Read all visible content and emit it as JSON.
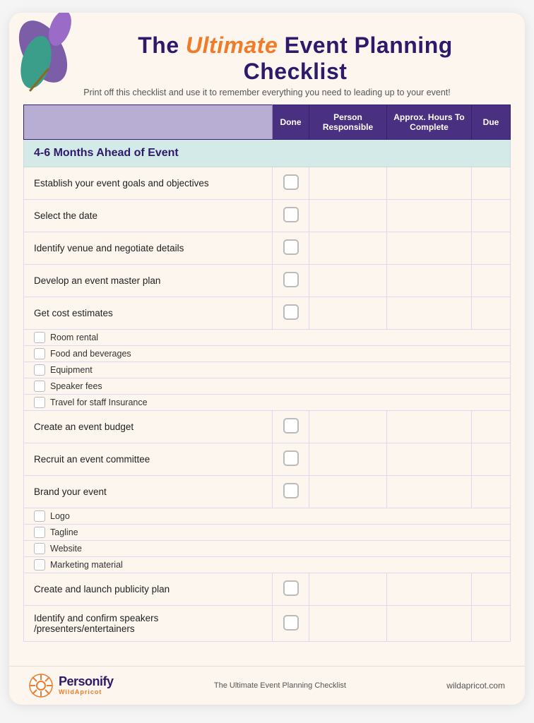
{
  "header": {
    "title_prefix": "The ",
    "title_highlight": "Ultimate",
    "title_suffix": " Event  Planning Checklist",
    "subtitle": "Print off this checklist and use it to remember everything you need to leading up to your event!"
  },
  "table": {
    "col_task": "",
    "col_done": "Done",
    "col_person": "Person Responsible",
    "col_hours": "Approx. Hours To Complete",
    "col_due": "Due"
  },
  "section1": {
    "label": "4-6 Months Ahead of Event",
    "items": [
      {
        "task": "Establish your event goals and objectives",
        "sub": []
      },
      {
        "task": "Select the date",
        "sub": []
      },
      {
        "task": "Identify venue and negotiate details",
        "sub": []
      },
      {
        "task": "Develop an event master plan",
        "sub": []
      },
      {
        "task": "Get cost estimates",
        "sub": [
          "Room rental",
          "Food and beverages",
          "Equipment",
          "Speaker fees",
          "Travel for staff Insurance"
        ]
      },
      {
        "task": "Create an event budget",
        "sub": []
      },
      {
        "task": "Recruit an event committee",
        "sub": []
      },
      {
        "task": "Brand your event",
        "sub": [
          "Logo",
          "Tagline",
          "Website",
          "Marketing material"
        ]
      },
      {
        "task": "Create and launch publicity plan",
        "sub": []
      },
      {
        "task": "Identify and confirm speakers\n/presenters/entertainers",
        "sub": []
      }
    ]
  },
  "footer": {
    "brand_name": "Personify",
    "brand_sub": "WildApricot",
    "center_text": "The Ultimate Event  Planning Checklist",
    "right_text": "wildapricot.com"
  }
}
